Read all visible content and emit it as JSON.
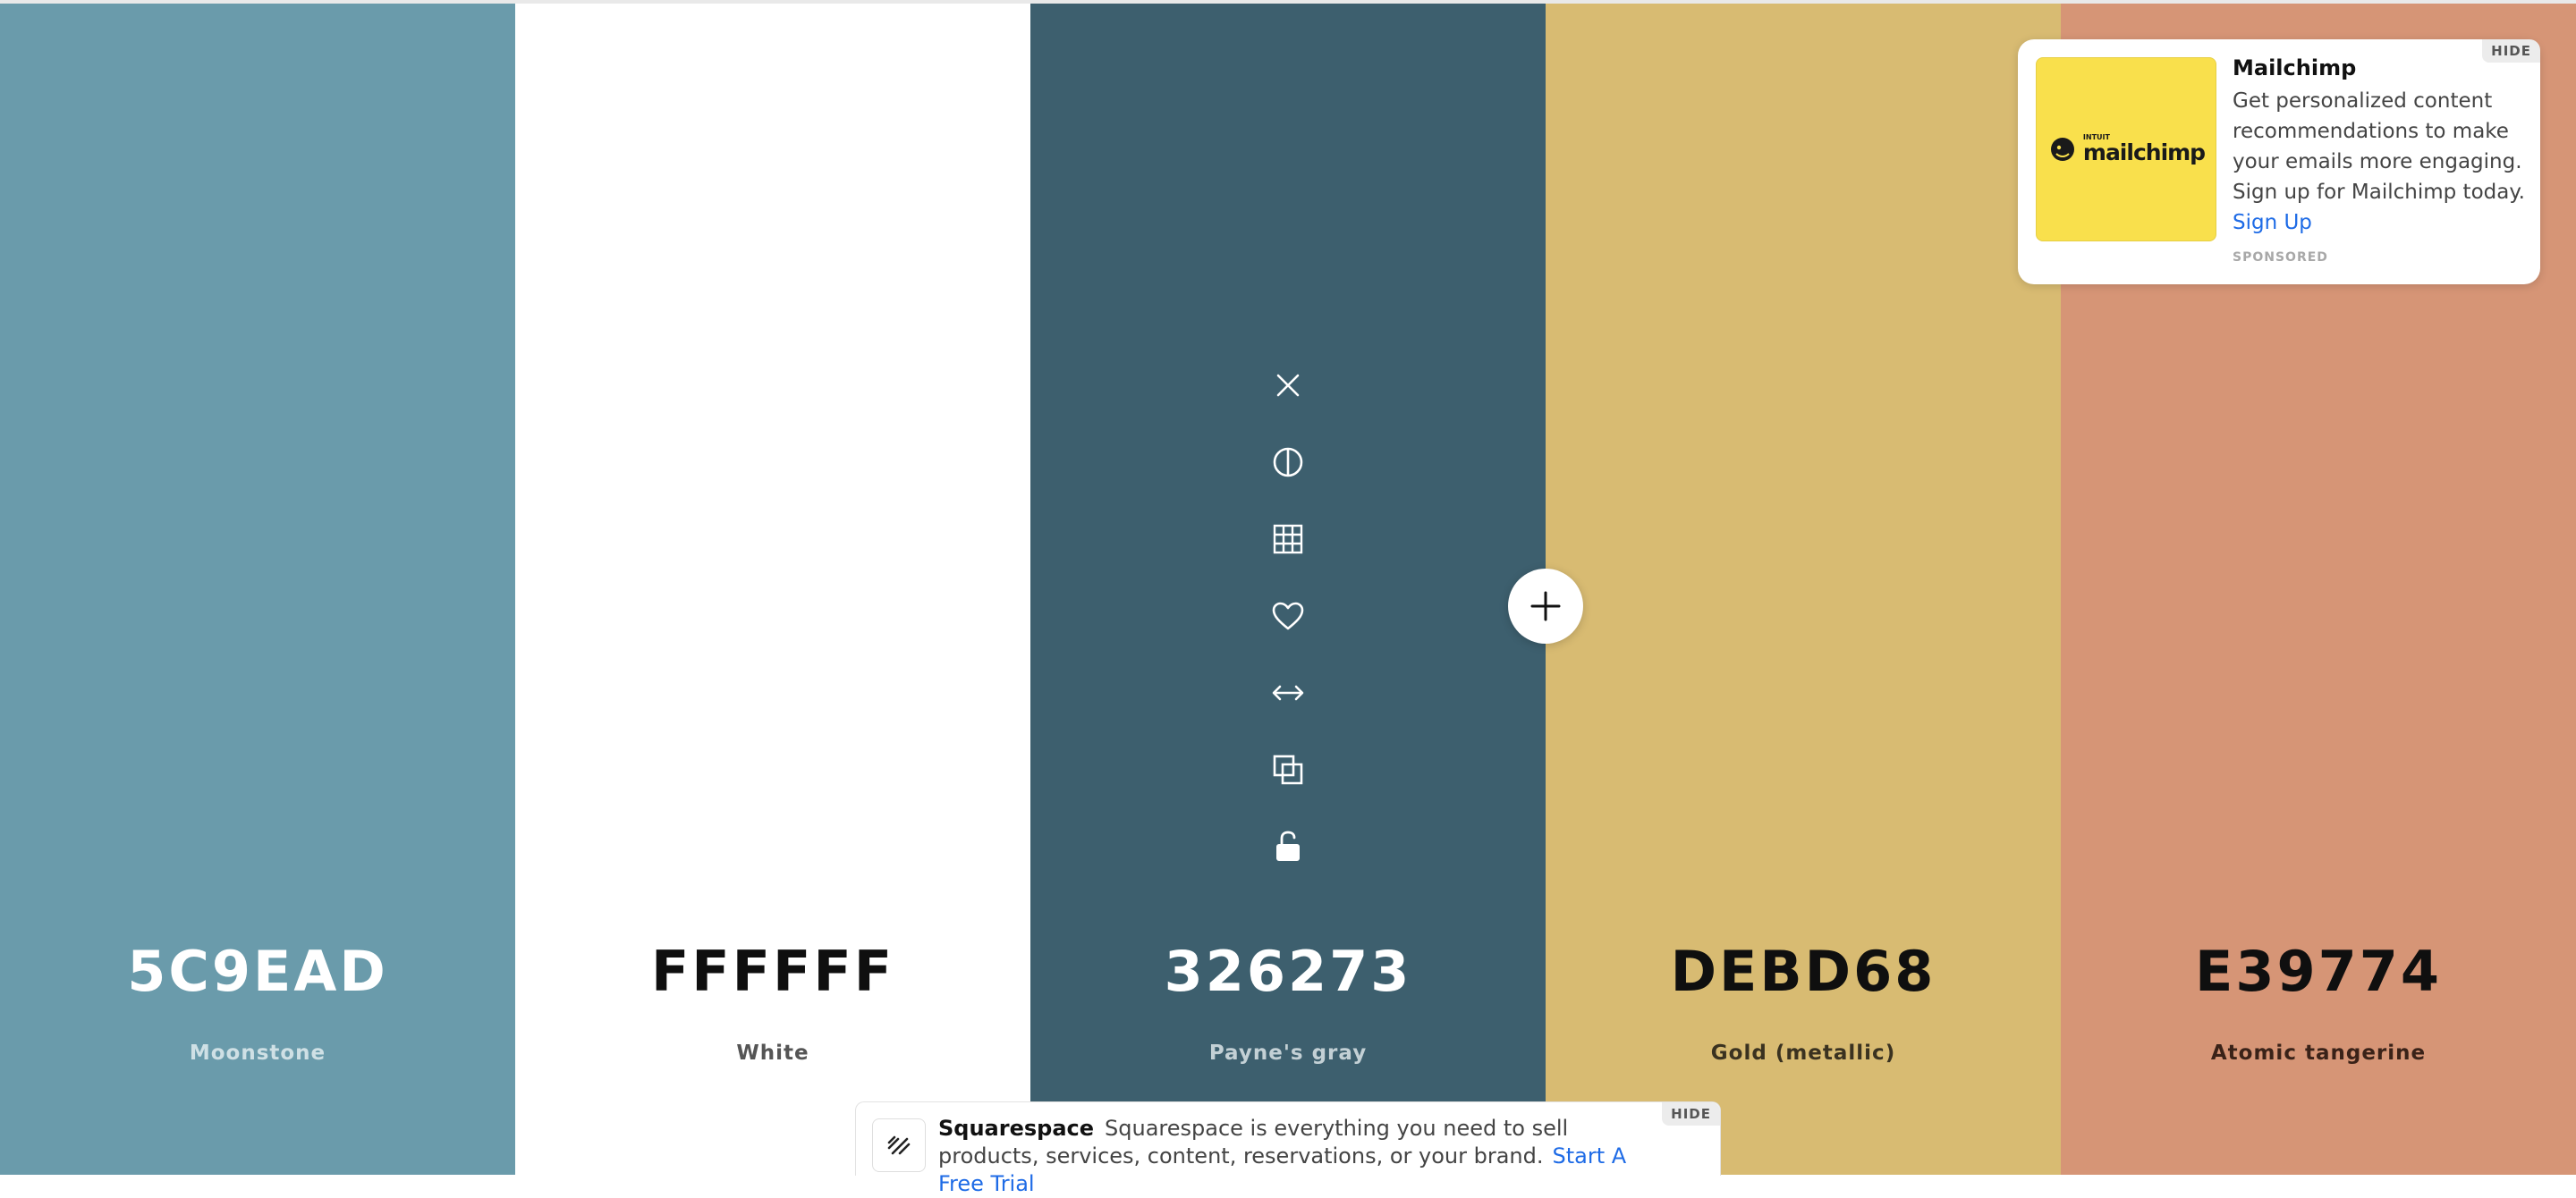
{
  "palette": [
    {
      "hex": "5C9EAD",
      "name": "Moonstone",
      "bg": "#6a9bab",
      "hex_color": "#ffffff",
      "name_color": "#cfe0e5"
    },
    {
      "hex": "FFFFFF",
      "name": "White",
      "bg": "#ffffff",
      "hex_color": "#0f0f0f",
      "name_color": "#555555"
    },
    {
      "hex": "326273",
      "name": "Payne's gray",
      "bg": "#3d5f6e",
      "hex_color": "#ffffff",
      "name_color": "#c3d0d5"
    },
    {
      "hex": "DEBD68",
      "name": "Gold (metallic)",
      "bg": "#d8bb72",
      "hex_color": "#0f0f0f",
      "name_color": "#3a3220"
    },
    {
      "hex": "E39774",
      "name": "Atomic tangerine",
      "bg": "#d69576",
      "hex_color": "#0f0f0f",
      "name_color": "#3a2218"
    }
  ],
  "toolbar": {
    "icons": [
      "close-icon",
      "contrast-icon",
      "grid-icon",
      "heart-icon",
      "arrows-horizontal-icon",
      "copy-icon",
      "unlock-icon"
    ]
  },
  "ad_card": {
    "title": "Mailchimp",
    "body": "Get personalized content recommendations to make your emails more engaging. Sign up for Mailchimp today.",
    "link": "Sign Up",
    "sponsored": "SPONSORED",
    "hide": "HIDE",
    "logo_prefix": "INTUIT",
    "logo_word": "mailchimp"
  },
  "bottom_ad": {
    "title": "Squarespace",
    "body": "Squarespace is everything you need to sell products, services, content, reservations, or your brand.",
    "link": "Start A Free Trial",
    "hide": "HIDE"
  }
}
